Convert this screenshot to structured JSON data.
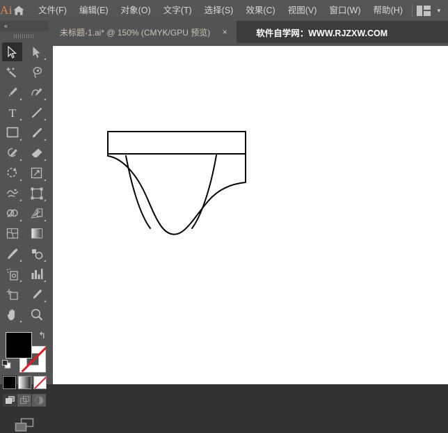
{
  "app": {
    "logo_text": "Ai",
    "home_icon": "home-icon"
  },
  "menubar": {
    "items": [
      {
        "label": "文件(F)"
      },
      {
        "label": "编辑(E)"
      },
      {
        "label": "对象(O)"
      },
      {
        "label": "文字(T)"
      },
      {
        "label": "选择(S)"
      },
      {
        "label": "效果(C)"
      },
      {
        "label": "视图(V)"
      },
      {
        "label": "窗口(W)"
      },
      {
        "label": "帮助(H)"
      }
    ],
    "arrange_icon": "arrange-documents-icon",
    "chevron": "▾"
  },
  "tabbar": {
    "active_tab": {
      "title": "未标题-1.ai* @ 150% (CMYK/GPU 预览)",
      "close": "×"
    },
    "watermark": "软件自学网：WWW.RJZXW.COM"
  },
  "toolbar": {
    "collapse": "«",
    "tools": [
      {
        "name": "selection-tool",
        "active": true
      },
      {
        "name": "direct-selection-tool",
        "active": false
      },
      {
        "name": "magic-wand-tool",
        "active": false
      },
      {
        "name": "lasso-tool",
        "active": false
      },
      {
        "name": "pen-tool",
        "active": false
      },
      {
        "name": "curvature-tool",
        "active": false
      },
      {
        "name": "type-tool",
        "active": false
      },
      {
        "name": "line-segment-tool",
        "active": false
      },
      {
        "name": "rectangle-tool",
        "active": false
      },
      {
        "name": "paintbrush-tool",
        "active": false
      },
      {
        "name": "shaper-tool",
        "active": false
      },
      {
        "name": "eraser-tool",
        "active": false
      },
      {
        "name": "rotate-tool",
        "active": false
      },
      {
        "name": "scale-tool",
        "active": false
      },
      {
        "name": "width-tool",
        "active": false
      },
      {
        "name": "free-transform-tool",
        "active": false
      },
      {
        "name": "shape-builder-tool",
        "active": false
      },
      {
        "name": "perspective-grid-tool",
        "active": false
      },
      {
        "name": "mesh-tool",
        "active": false
      },
      {
        "name": "gradient-tool",
        "active": false
      },
      {
        "name": "eyedropper-tool",
        "active": false
      },
      {
        "name": "blend-tool",
        "active": false
      },
      {
        "name": "symbol-sprayer-tool",
        "active": false
      },
      {
        "name": "column-graph-tool",
        "active": false
      },
      {
        "name": "artboard-tool",
        "active": false
      },
      {
        "name": "slice-tool",
        "active": false
      },
      {
        "name": "hand-tool",
        "active": false
      },
      {
        "name": "zoom-tool",
        "active": false
      }
    ],
    "swatches": {
      "fill_color": "#000000",
      "stroke_color": "none",
      "swap_icon": "↰",
      "default_icon": "default-fill-stroke-icon"
    },
    "mode_buttons": [
      {
        "name": "color-mode-button",
        "active": true
      },
      {
        "name": "gradient-mode-button",
        "active": false
      },
      {
        "name": "none-mode-button",
        "active": false
      }
    ],
    "draw_modes": [
      {
        "name": "draw-normal-button",
        "active": true
      },
      {
        "name": "draw-behind-button",
        "active": false
      },
      {
        "name": "draw-inside-button",
        "active": false
      }
    ],
    "screen_mode": "change-screen-mode-button"
  },
  "canvas": {
    "background": "#ffffff",
    "artwork": {
      "name": "briefs-underwear-drawing",
      "stroke_color": "#000000",
      "fill_color": "#ffffff",
      "stroke_width": 2
    }
  }
}
